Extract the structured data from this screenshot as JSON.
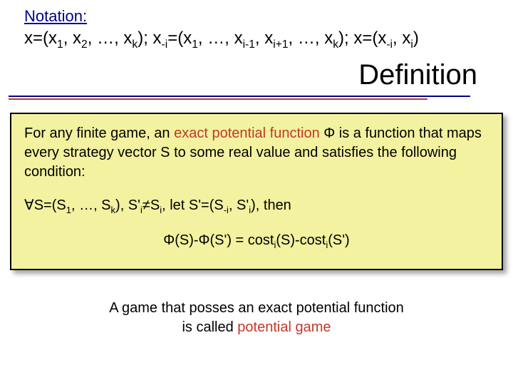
{
  "notation": {
    "label": "Notation:",
    "line_parts": {
      "p1a": "x=(x",
      "p1b": ", x",
      "p1c": ", …, x",
      "p1d": ");   x",
      "p2a": "=(x",
      "p2b": ", …, x",
      "p2c": ", x",
      "p2d": ", …, x",
      "p2e": ");  x=(x",
      "p3a": ", x",
      "p3b": ")",
      "s1": "1",
      "s2": "2",
      "sk": "k",
      "sNegI": "-i",
      "sIminus1": "i-1",
      "sIplus1": "i+1",
      "sI": "i"
    }
  },
  "heading": "Definition",
  "def": {
    "para1_a": "For any finite game, an ",
    "para1_b": "exact potential function",
    "para1_c": " Φ is a function that maps every strategy vector S to some real value and satisfies the following condition:",
    "formula1_parts": {
      "forall": "∀",
      "a": "S=(S",
      "s1": "1",
      "b": ", …, S",
      "sk": "k",
      "c": "), S'",
      "si": "i",
      "ne": "≠",
      "d": "S",
      "si2": "i",
      "e": ", let S'=(S",
      "sNegI": "-i",
      "f": ", S'",
      "si3": "i",
      "g": "), then"
    },
    "formula2_parts": {
      "a": "Φ(S)-Φ(S') = cost",
      "si1": "i",
      "b": "(S)-cost",
      "si2": "i",
      "c": "(S')"
    }
  },
  "footer": {
    "line1": "A game that posses an exact potential function",
    "line2a": "is called ",
    "line2b": "potential game"
  }
}
